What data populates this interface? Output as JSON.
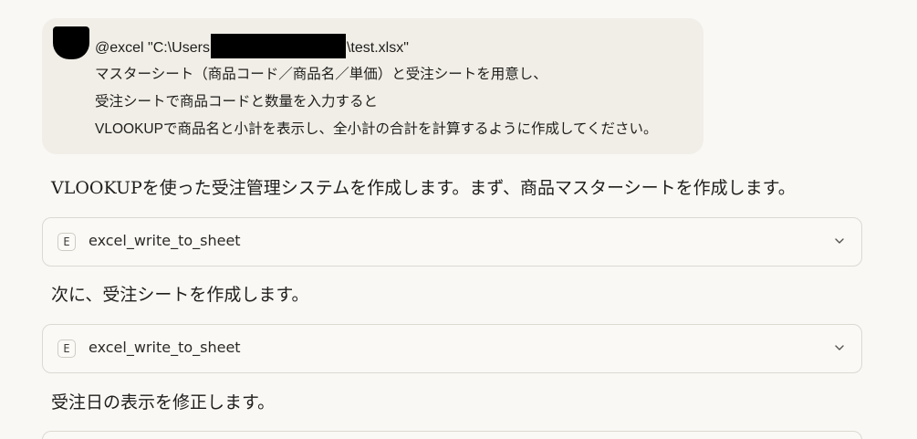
{
  "user_message": {
    "path_prefix": "@excel \"C:\\Users",
    "path_suffix": "\\test.xlsx\"",
    "lines": [
      "マスターシート（商品コード／商品名／単価）と受注シートを用意し、",
      "受注シートで商品コードと数量を入力すると",
      "VLOOKUPで商品名と小計を表示し、全小計の合計を計算するように作成してください。"
    ]
  },
  "assistant": {
    "intro": "VLOOKUPを使った受注管理システムを作成します。まず、商品マスターシートを作成します。",
    "step2": "次に、受注シートを作成します。",
    "step3": "受注日の表示を修正します。"
  },
  "tool_calls": [
    {
      "badge": "E",
      "name": "excel_write_to_sheet",
      "icon": "chevron-down-icon"
    },
    {
      "badge": "E",
      "name": "excel_write_to_sheet",
      "icon": "chevron-down-icon"
    }
  ]
}
